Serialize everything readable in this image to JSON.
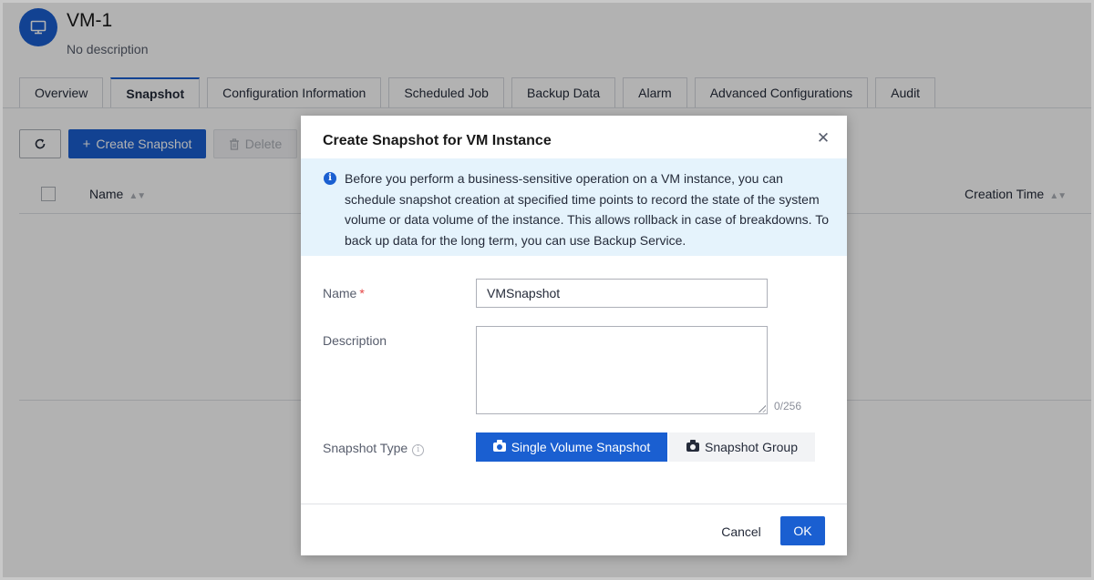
{
  "page": {
    "vm_name": "VM-1",
    "vm_description": "No description"
  },
  "tabs": [
    {
      "label": "Overview"
    },
    {
      "label": "Snapshot",
      "active": true
    },
    {
      "label": "Configuration Information"
    },
    {
      "label": "Scheduled Job"
    },
    {
      "label": "Backup Data"
    },
    {
      "label": "Alarm"
    },
    {
      "label": "Advanced Configurations"
    },
    {
      "label": "Audit"
    }
  ],
  "toolbar": {
    "create_label": "Create Snapshot",
    "delete_label": "Delete"
  },
  "table": {
    "col_name": "Name",
    "col_creation_time": "Creation Time"
  },
  "dialog": {
    "title": "Create Snapshot for VM Instance",
    "info": "Before you perform a business-sensitive operation on a VM instance, you can schedule snapshot creation at specified time points to record the state of the system volume or data volume of the instance. This allows rollback in case of breakdowns. To back up data for the long term, you can use Backup Service.",
    "name_label": "Name",
    "name_required_mark": "*",
    "name_value": "VMSnapshot",
    "description_label": "Description",
    "description_value": "",
    "description_counter": "0/256",
    "snapshot_type_label": "Snapshot Type",
    "snapshot_types": [
      {
        "label": "Single Volume Snapshot",
        "selected": true
      },
      {
        "label": "Snapshot Group",
        "selected": false
      }
    ],
    "cancel_label": "Cancel",
    "ok_label": "OK"
  },
  "colors": {
    "primary": "#1a5fd1",
    "info_background": "#e5f3fc",
    "required": "#e54545"
  },
  "icons": {
    "vm": "monitor-icon",
    "refresh": "refresh-icon",
    "add": "plus-icon",
    "delete": "trash-icon",
    "info": "info-icon",
    "close": "close-icon",
    "help": "help-icon",
    "camera": "camera-icon"
  }
}
